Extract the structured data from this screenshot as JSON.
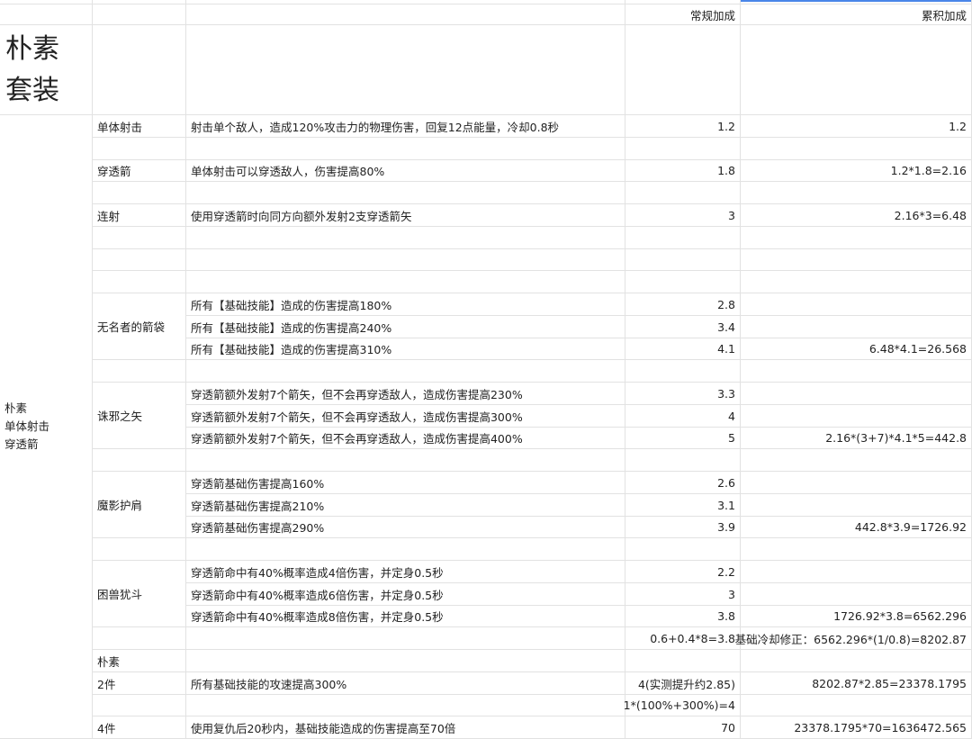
{
  "header": {
    "regular_label": "常规加成",
    "cumulative_label": "累积加成"
  },
  "title": "朴素\n套装",
  "side_label": "朴素\n单体射击\n穿透箭",
  "rows": [
    {
      "name": "单体射击",
      "desc": "射击单个敌人，造成120%攻击力的物理伤害，回复12点能量，冷却0.8秒",
      "regular": "1.2",
      "cumulative": "1.2"
    },
    {
      "name": "",
      "desc": "",
      "regular": "",
      "cumulative": ""
    },
    {
      "name": "穿透箭",
      "desc": "单体射击可以穿透敌人，伤害提高80%",
      "regular": "1.8",
      "cumulative": "1.2*1.8=2.16"
    },
    {
      "name": "",
      "desc": "",
      "regular": "",
      "cumulative": ""
    },
    {
      "name": "连射",
      "desc": "使用穿透箭时向同方向额外发射2支穿透箭矢",
      "regular": "3",
      "cumulative": "2.16*3=6.48"
    },
    {
      "name": "",
      "desc": "",
      "regular": "",
      "cumulative": ""
    },
    {
      "name": "",
      "desc": "",
      "regular": "",
      "cumulative": ""
    },
    {
      "name": "",
      "desc": "",
      "regular": "",
      "cumulative": ""
    },
    {
      "name": "无名者的箭袋",
      "desc": "所有【基础技能】造成的伤害提高180%",
      "regular": "2.8",
      "cumulative": ""
    },
    {
      "name": "",
      "desc": "所有【基础技能】造成的伤害提高240%",
      "regular": "3.4",
      "cumulative": ""
    },
    {
      "name": "",
      "desc": "所有【基础技能】造成的伤害提高310%",
      "regular": "4.1",
      "cumulative": "6.48*4.1=26.568"
    },
    {
      "name": "",
      "desc": "",
      "regular": "",
      "cumulative": ""
    },
    {
      "name": "诛邪之矢",
      "desc": "穿透箭额外发射7个箭矢，但不会再穿透敌人，造成伤害提高230%",
      "regular": "3.3",
      "cumulative": ""
    },
    {
      "name": "",
      "desc": "穿透箭额外发射7个箭矢，但不会再穿透敌人，造成伤害提高300%",
      "regular": "4",
      "cumulative": ""
    },
    {
      "name": "",
      "desc": "穿透箭额外发射7个箭矢，但不会再穿透敌人，造成伤害提高400%",
      "regular": "5",
      "cumulative": "2.16*(3+7)*4.1*5=442.8"
    },
    {
      "name": "",
      "desc": "",
      "regular": "",
      "cumulative": ""
    },
    {
      "name": "魔影护肩",
      "desc": "穿透箭基础伤害提高160%",
      "regular": "2.6",
      "cumulative": ""
    },
    {
      "name": "",
      "desc": "穿透箭基础伤害提高210%",
      "regular": "3.1",
      "cumulative": ""
    },
    {
      "name": "",
      "desc": "穿透箭基础伤害提高290%",
      "regular": "3.9",
      "cumulative": "442.8*3.9=1726.92"
    },
    {
      "name": "",
      "desc": "",
      "regular": "",
      "cumulative": ""
    },
    {
      "name": "困兽犹斗",
      "desc": "穿透箭命中有40%概率造成4倍伤害，并定身0.5秒",
      "regular": "2.2",
      "cumulative": ""
    },
    {
      "name": "",
      "desc": "穿透箭命中有40%概率造成6倍伤害，并定身0.5秒",
      "regular": "3",
      "cumulative": ""
    },
    {
      "name": "",
      "desc": "穿透箭命中有40%概率造成8倍伤害，并定身0.5秒",
      "regular": "3.8",
      "cumulative": "1726.92*3.8=6562.296"
    },
    {
      "name": "",
      "desc": "",
      "regular": "0.6+0.4*8=3.8",
      "cumulative": "基础冷却修正：6562.296*(1/0.8)=8202.87"
    },
    {
      "name": "朴素",
      "desc": "",
      "regular": "",
      "cumulative": ""
    },
    {
      "name": "2件",
      "desc": "所有基础技能的攻速提高300%",
      "regular": "4(实测提升约2.85)",
      "cumulative": "8202.87*2.85=23378.1795"
    },
    {
      "name": "",
      "desc": "",
      "regular": "1*(100%+300%)=4",
      "cumulative": ""
    },
    {
      "name": "4件",
      "desc": "使用复仇后20秒内，基础技能造成的伤害提高至70倍",
      "regular": "70",
      "cumulative": "23378.1795*70=1636472.565"
    }
  ]
}
